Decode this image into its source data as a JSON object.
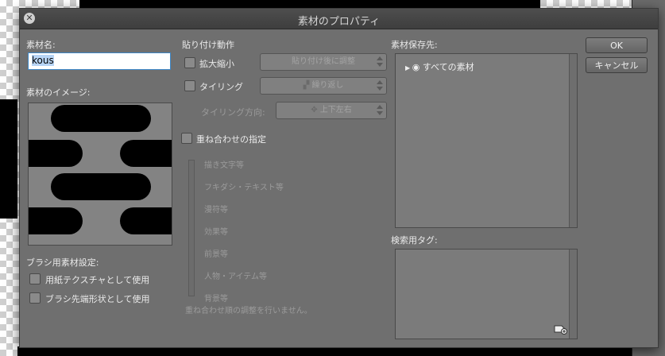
{
  "dialog": {
    "title": "素材のプロパティ",
    "name_label": "素材名:",
    "name_value": "kous",
    "image_label": "素材のイメージ:",
    "brush_settings_label": "ブラシ用素材設定:",
    "use_as_paper_texture": "用紙テクスチャとして使用",
    "use_as_brush_tip": "ブラシ先端形状として使用"
  },
  "paste": {
    "label": "貼り付け動作",
    "scale_label": "拡大縮小",
    "scale_select": "貼り付け後に調整",
    "tiling_label": "タイリング",
    "tiling_select": "繰り返し",
    "tiling_dir_label": "タイリング方向:",
    "tiling_dir_select": "上下左右"
  },
  "layer_order": {
    "label": "重ね合わせの指定",
    "items": [
      "描き文字等",
      "フキダシ・テキスト等",
      "漫符等",
      "効果等",
      "前景等",
      "人物・アイテム等",
      "背景等"
    ],
    "note": "重ね合わせ順の調整を行いません。"
  },
  "storage": {
    "label": "素材保存先:",
    "tree_item": "すべての素材"
  },
  "tags": {
    "label": "検索用タグ:"
  },
  "buttons": {
    "ok": "OK",
    "cancel": "キャンセル"
  },
  "colors": {
    "dialog_bg": "#6f6f6f",
    "accent": "#3d86c6"
  }
}
